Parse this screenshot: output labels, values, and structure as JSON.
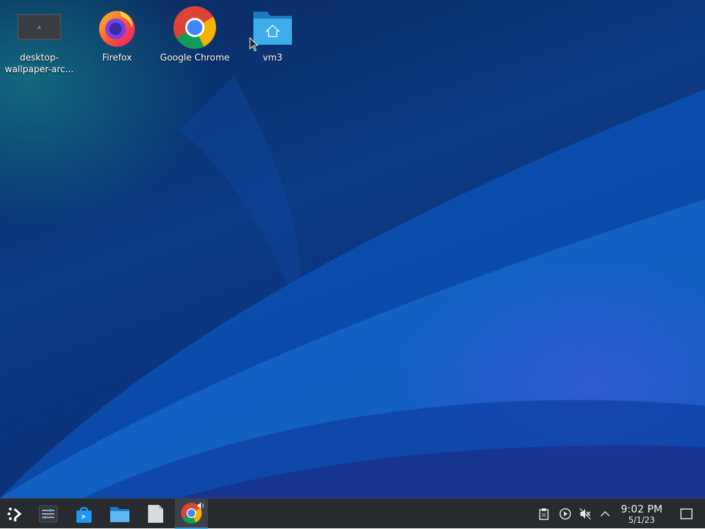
{
  "desktop": {
    "icons": [
      {
        "label": "desktop-\nwallpaper-arc...",
        "icon": "image-thumbnail-icon"
      },
      {
        "label": "Firefox",
        "icon": "firefox-icon"
      },
      {
        "label": "Google Chrome",
        "icon": "chrome-icon"
      },
      {
        "label": "vm3",
        "icon": "home-folder-icon"
      }
    ]
  },
  "taskbar": {
    "launchers": [
      {
        "icon": "app-launcher-icon"
      },
      {
        "icon": "system-settings-icon"
      },
      {
        "icon": "discover-store-icon"
      },
      {
        "icon": "file-manager-icon"
      },
      {
        "icon": "text-editor-icon"
      },
      {
        "icon": "chrome-icon",
        "active": true,
        "badge": "audio-playing-icon"
      }
    ],
    "tray": [
      {
        "icon": "clipboard-icon"
      },
      {
        "icon": "media-player-icon"
      },
      {
        "icon": "volume-muted-icon"
      },
      {
        "icon": "chevron-up-icon"
      }
    ],
    "clock": {
      "time": "9:02 PM",
      "date": "5/1/23"
    },
    "show_desktop_icon": "show-desktop-icon"
  },
  "colors": {
    "accent": "#3daee9",
    "taskbar_bg": "#272b30"
  }
}
